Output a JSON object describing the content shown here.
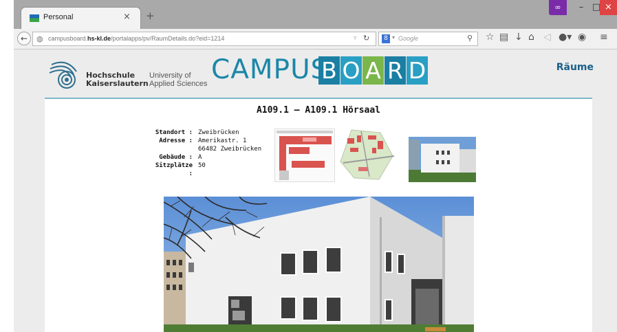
{
  "browser": {
    "tab_title": "Personal",
    "tab_close": "×",
    "new_tab": "+",
    "url_plain_prefix": "campusboard.",
    "url_domain": "hs-kl.de",
    "url_path": "/portalapps/pv/RaumDetails.do?eid=1214",
    "search_engine_glyph": "8",
    "search_placeholder": "Google"
  },
  "header": {
    "school_line1": "Hochschule",
    "school_line2": "Kaiserslautern",
    "uni_line1": "University of",
    "uni_line2": "Applied Sciences",
    "campus_word": "CAMPUS",
    "board_letters": [
      "B",
      "O",
      "A",
      "R",
      "D"
    ],
    "board_colors": [
      "#1a7fa3",
      "#2a9fc4",
      "#7ab64a",
      "#1a7fa3",
      "#2a9fc4"
    ],
    "nav_link": "Räume"
  },
  "room": {
    "title": "A109.1 — A109.1 Hörsaal",
    "fields": [
      {
        "label": "Standort :",
        "value": "Zweibrücken"
      },
      {
        "label": "Adresse :",
        "value": "Amerikastr. 1"
      },
      {
        "label": "",
        "value": "66482 Zweibrücken"
      },
      {
        "label": "Gebäude :",
        "value": "A"
      },
      {
        "label": "Sitzplätze :",
        "value": "50"
      }
    ]
  },
  "colors": {
    "accent": "#1c87a8",
    "close_button": "#e04343",
    "private_mask": "#7a2ca8"
  }
}
